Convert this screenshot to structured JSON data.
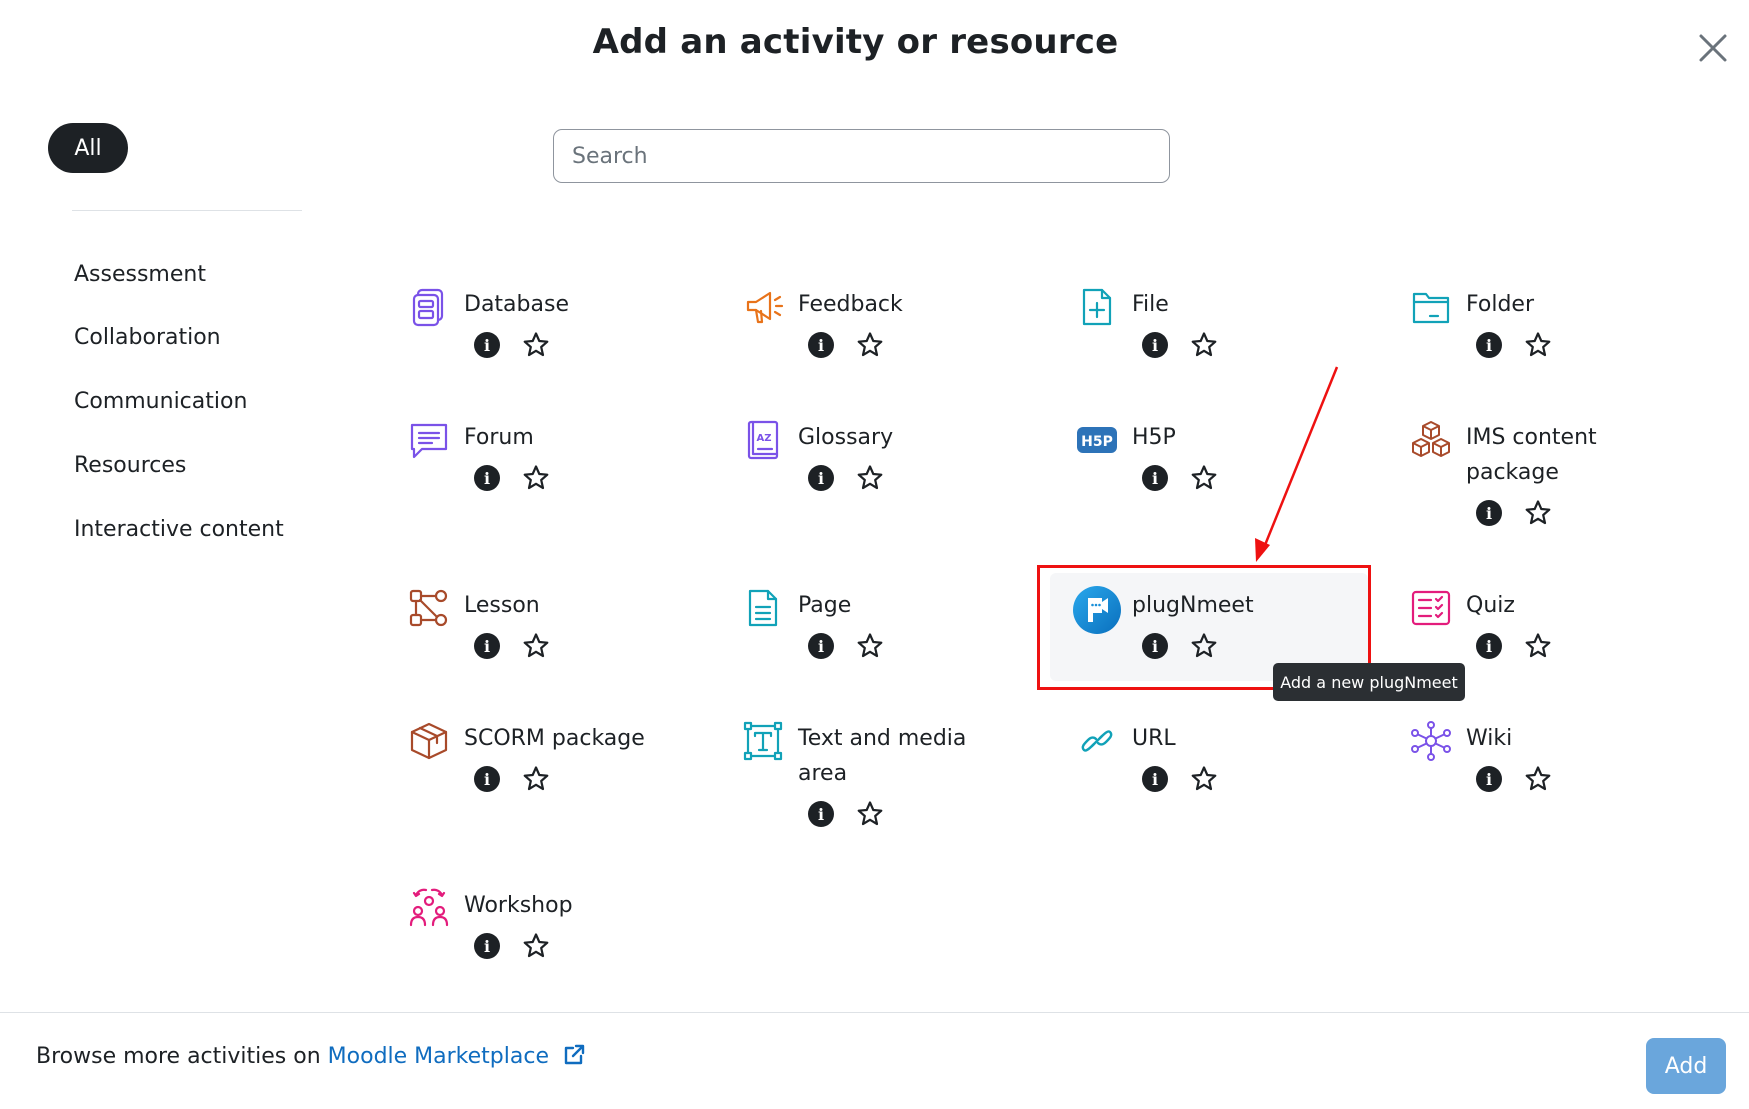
{
  "modal": {
    "title": "Add an activity or resource"
  },
  "sidebar": {
    "all_label": "All",
    "items": [
      {
        "label": "Assessment"
      },
      {
        "label": "Collaboration"
      },
      {
        "label": "Communication"
      },
      {
        "label": "Resources"
      },
      {
        "label": "Interactive content"
      }
    ]
  },
  "search": {
    "placeholder": "Search",
    "value": ""
  },
  "activities": [
    {
      "name": "Database",
      "icon": "database-icon",
      "color": "#7a52e8"
    },
    {
      "name": "Feedback",
      "icon": "megaphone-icon",
      "color": "#e8731a"
    },
    {
      "name": "File",
      "icon": "file-plus-icon",
      "color": "#11a2b8"
    },
    {
      "name": "Folder",
      "icon": "folder-icon",
      "color": "#11a2b8"
    },
    {
      "name": "Forum",
      "icon": "chat-bubble-icon",
      "color": "#7a52e8"
    },
    {
      "name": "Glossary",
      "icon": "glossary-book-icon",
      "color": "#7a52e8"
    },
    {
      "name": "H5P",
      "icon": "h5p-icon",
      "color": "#2d73b8"
    },
    {
      "name": "IMS content package",
      "icon": "cubes-icon",
      "color": "#a84a2a"
    },
    {
      "name": "Lesson",
      "icon": "lesson-nodes-icon",
      "color": "#a84a2a"
    },
    {
      "name": "Page",
      "icon": "page-icon",
      "color": "#11a2b8"
    },
    {
      "name": "plugNmeet",
      "icon": "plugnmeet-logo-icon",
      "color": "#1a8fd8"
    },
    {
      "name": "Quiz",
      "icon": "quiz-checklist-icon",
      "color": "#e31c7c"
    },
    {
      "name": "SCORM package",
      "icon": "package-box-icon",
      "color": "#a84a2a"
    },
    {
      "name": "Text and media area",
      "icon": "text-media-icon",
      "color": "#11a2b8"
    },
    {
      "name": "URL",
      "icon": "link-icon",
      "color": "#11a2b8"
    },
    {
      "name": "Wiki",
      "icon": "wiki-network-icon",
      "color": "#7a52e8"
    },
    {
      "name": "Workshop",
      "icon": "workshop-people-icon",
      "color": "#e31c7c"
    }
  ],
  "tooltip": {
    "text": "Add a new plugNmeet"
  },
  "footer": {
    "browse_text": "Browse more activities on",
    "marketplace_link": "Moodle Marketplace",
    "add_label": "Add"
  },
  "colors": {
    "accent": "#0f6cbf",
    "annotation": "#ee1111",
    "add_button": "#6aa6dc"
  }
}
